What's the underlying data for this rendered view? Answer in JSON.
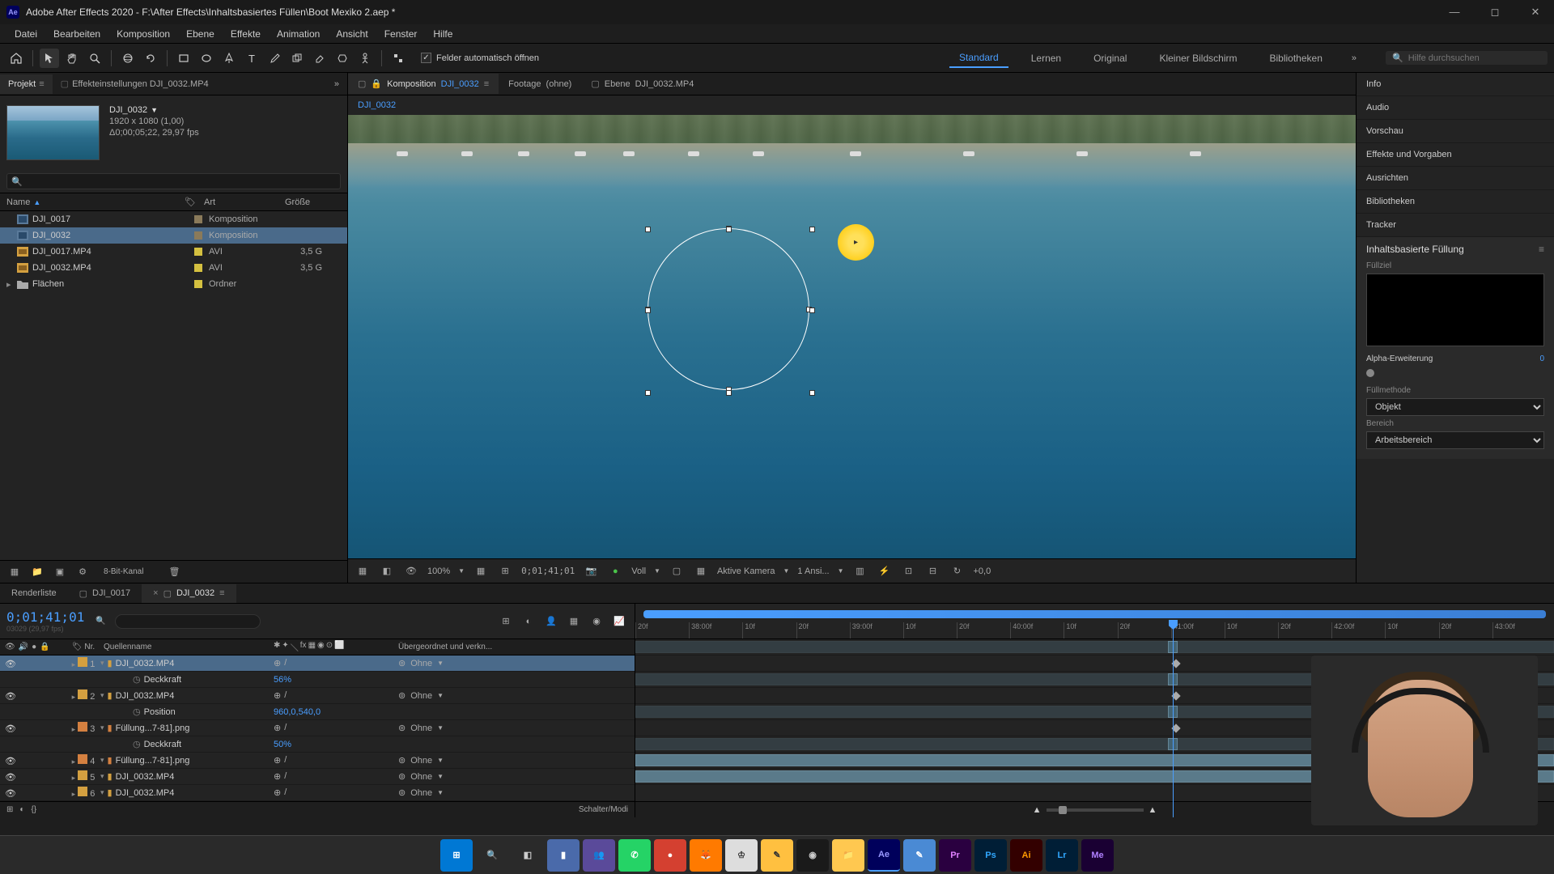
{
  "titlebar": {
    "app_icon_text": "Ae",
    "title": "Adobe After Effects 2020 - F:\\After Effects\\Inhaltsbasiertes Füllen\\Boot Mexiko 2.aep *"
  },
  "menubar": [
    "Datei",
    "Bearbeiten",
    "Komposition",
    "Ebene",
    "Effekte",
    "Animation",
    "Ansicht",
    "Fenster",
    "Hilfe"
  ],
  "toolbar": {
    "auto_open_label": "Felder automatisch öffnen",
    "workspaces": [
      "Standard",
      "Lernen",
      "Original",
      "Kleiner Bildschirm",
      "Bibliotheken"
    ],
    "active_workspace": "Standard",
    "search_placeholder": "Hilfe durchsuchen"
  },
  "project": {
    "tabs": {
      "project": "Projekt",
      "effect": "Effekteinstellungen DJI_0032.MP4"
    },
    "selected_name": "DJI_0032",
    "selected_res": "1920 x 1080 (1,00)",
    "selected_dur": "Δ0;00;05;22, 29,97 fps",
    "cols": {
      "name": "Name",
      "type": "Art",
      "size": "Größe"
    },
    "items": [
      {
        "name": "DJI_0017",
        "type": "Komposition",
        "size": "",
        "color": "#8a7a5a",
        "icon": "comp"
      },
      {
        "name": "DJI_0032",
        "type": "Komposition",
        "size": "",
        "color": "#8a7a5a",
        "icon": "comp",
        "selected": true
      },
      {
        "name": "DJI_0017.MP4",
        "type": "AVI",
        "size": "3,5 G",
        "color": "#d4c040",
        "icon": "video"
      },
      {
        "name": "DJI_0032.MP4",
        "type": "AVI",
        "size": "3,5 G",
        "color": "#d4c040",
        "icon": "video"
      },
      {
        "name": "Flächen",
        "type": "Ordner",
        "size": "",
        "color": "#d4c040",
        "icon": "folder"
      }
    ],
    "footer_bpc": "8-Bit-Kanal"
  },
  "comp": {
    "tabs": {
      "comp_label": "Komposition",
      "comp_name": "DJI_0032",
      "footage_label": "Footage",
      "footage_val": "(ohne)",
      "layer_label": "Ebene",
      "layer_val": "DJI_0032.MP4"
    },
    "breadcrumb": "DJI_0032",
    "footer": {
      "zoom": "100%",
      "timecode": "0;01;41;01",
      "res": "Voll",
      "camera": "Aktive Kamera",
      "views": "1 Ansi...",
      "exposure": "+0,0"
    }
  },
  "right_panels": [
    "Info",
    "Audio",
    "Vorschau",
    "Effekte und Vorgaben",
    "Ausrichten",
    "Bibliotheken",
    "Tracker"
  ],
  "caf": {
    "title": "Inhaltsbasierte Füllung",
    "fill_target": "Füllziel",
    "alpha_label": "Alpha-Erweiterung",
    "alpha_val": "0",
    "method_label": "Füllmethode",
    "method_val": "Objekt",
    "range_label": "Bereich",
    "range_val": "Arbeitsbereich"
  },
  "timeline": {
    "tabs": [
      "Renderliste",
      "DJI_0017",
      "DJI_0032"
    ],
    "active_tab": "DJI_0032",
    "timecode": "0;01;41;01",
    "subtime": "03029 (29,97 fps)",
    "cols": {
      "nr": "Nr.",
      "source": "Quellenname",
      "parent": "Übergeordnet und verkn..."
    },
    "layers": [
      {
        "nr": 1,
        "name": "DJI_0032.MP4",
        "color": "#d4a040",
        "parent": "Ohne",
        "selected": true,
        "props": [
          {
            "name": "Deckkraft",
            "val": "56%"
          }
        ]
      },
      {
        "nr": 2,
        "name": "DJI_0032.MP4",
        "color": "#d4a040",
        "parent": "Ohne",
        "props": [
          {
            "name": "Position",
            "val": "960,0,540,0"
          }
        ]
      },
      {
        "nr": 3,
        "name": "Füllung...7-81].png",
        "color": "#d48040",
        "parent": "Ohne",
        "props": [
          {
            "name": "Deckkraft",
            "val": "50%"
          }
        ]
      },
      {
        "nr": 4,
        "name": "Füllung...7-81].png",
        "color": "#d48040",
        "parent": "Ohne"
      },
      {
        "nr": 5,
        "name": "DJI_0032.MP4",
        "color": "#d4a040",
        "parent": "Ohne"
      },
      {
        "nr": 6,
        "name": "DJI_0032.MP4",
        "color": "#d4a040",
        "parent": "Ohne"
      }
    ],
    "ticks": [
      "20f",
      "38:00f",
      "10f",
      "20f",
      "39:00f",
      "10f",
      "20f",
      "40:00f",
      "10f",
      "20f",
      "41:00f",
      "10f",
      "20f",
      "42:00f",
      "10f",
      "20f",
      "43:00f"
    ],
    "footer_mode": "Schalter/Modi"
  },
  "taskbar": {
    "icons": [
      {
        "name": "start",
        "bg": "#0078d4",
        "txt": "⊞",
        "fg": "#fff"
      },
      {
        "name": "search",
        "bg": "transparent",
        "txt": "🔍",
        "fg": "#ccc"
      },
      {
        "name": "taskview",
        "bg": "transparent",
        "txt": "◧",
        "fg": "#ccc"
      },
      {
        "name": "app1",
        "bg": "#4a6aaa",
        "txt": "▮",
        "fg": "#fff"
      },
      {
        "name": "teams",
        "bg": "#5a4a9a",
        "txt": "👥",
        "fg": "#fff"
      },
      {
        "name": "whatsapp",
        "bg": "#25d366",
        "txt": "✆",
        "fg": "#fff"
      },
      {
        "name": "app2",
        "bg": "#d44030",
        "txt": "●",
        "fg": "#fff"
      },
      {
        "name": "firefox",
        "bg": "#ff7a00",
        "txt": "🦊",
        "fg": "#fff"
      },
      {
        "name": "app3",
        "bg": "#ddd",
        "txt": "♔",
        "fg": "#333"
      },
      {
        "name": "app4",
        "bg": "#ffc040",
        "txt": "✎",
        "fg": "#333"
      },
      {
        "name": "obs",
        "bg": "#1a1a1a",
        "txt": "◉",
        "fg": "#ccc"
      },
      {
        "name": "explorer",
        "bg": "#ffc850",
        "txt": "📁",
        "fg": "#333"
      },
      {
        "name": "ae",
        "bg": "#00005b",
        "txt": "Ae",
        "fg": "#9999ff",
        "active": true
      },
      {
        "name": "notes",
        "bg": "#4a8ad4",
        "txt": "✎",
        "fg": "#fff"
      },
      {
        "name": "pr",
        "bg": "#2a0040",
        "txt": "Pr",
        "fg": "#e080ff"
      },
      {
        "name": "ps",
        "bg": "#001e36",
        "txt": "Ps",
        "fg": "#31a8ff"
      },
      {
        "name": "ai",
        "bg": "#330000",
        "txt": "Ai",
        "fg": "#ff9a00"
      },
      {
        "name": "lr",
        "bg": "#001e36",
        "txt": "Lr",
        "fg": "#31a8ff"
      },
      {
        "name": "me",
        "bg": "#1a0033",
        "txt": "Me",
        "fg": "#b080ff"
      }
    ]
  }
}
